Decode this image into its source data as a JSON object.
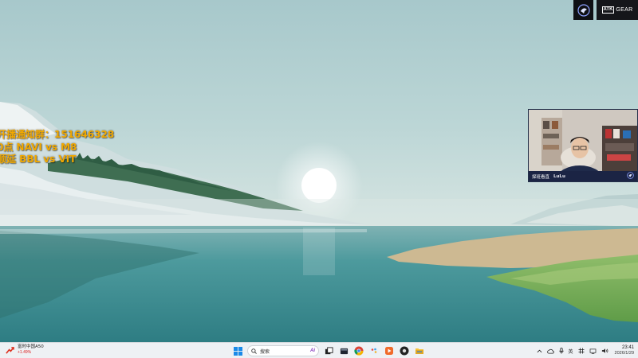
{
  "overlay": {
    "lines": [
      "开播通知群：151646328",
      "0点 NAVI vs M8",
      "顺延 BBL vs VIT"
    ],
    "color": "#f2a900"
  },
  "brand": {
    "sponsor_badge": "ATK",
    "sponsor_word": "GEAR"
  },
  "webcam": {
    "channel_label": "探班看直",
    "tag_label": "LuLu"
  },
  "taskbar": {
    "widget": {
      "title": "富时中国A50",
      "change": "+1.49%"
    },
    "search_placeholder": "搜索",
    "search_deco": "Ai",
    "apps": [
      "windows-start",
      "search",
      "task-view",
      "file-manager",
      "chrome",
      "paint-app",
      "media-app",
      "obs-app",
      "file-explorer"
    ],
    "tray": {
      "language": "英",
      "time": "23:41",
      "date": "2026/1/29"
    }
  },
  "colors": {
    "sky_top": "#a8c9cc",
    "water": "#3e8d92",
    "taskbar_bg": "#eef1f4"
  }
}
